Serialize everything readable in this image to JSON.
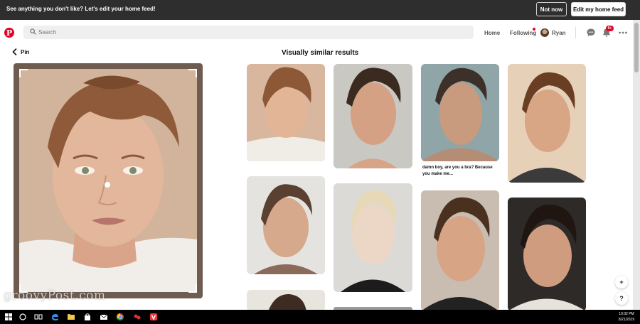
{
  "banner": {
    "message": "See anything you don't like? Let's edit your home feed!",
    "not_now_label": "Not now",
    "edit_label": "Edit my home feed"
  },
  "header": {
    "logo_letter": "P",
    "search_placeholder": "Search",
    "nav": {
      "home": "Home",
      "following": "Following",
      "user": "Ryan"
    },
    "notification_count": "9+",
    "icons": [
      "pinterest-logo-icon",
      "search-icon",
      "messages-icon",
      "notifications-bell-icon",
      "more-options-icon"
    ]
  },
  "pin": {
    "back_label": "Pin"
  },
  "results": {
    "title": "Visually similar results",
    "caption": "damn boy, are you a bra? Because you make me..."
  },
  "floating": {
    "add": "+",
    "help": "?"
  },
  "watermark": "groovyPost.com",
  "taskbar": {
    "time": "10:32 PM",
    "date": "8/21/2019",
    "icons": [
      "windows-start-icon",
      "cortana-search-icon",
      "task-view-icon",
      "edge-icon",
      "file-explorer-icon",
      "store-icon",
      "mail-icon",
      "chrome-icon",
      "app-icon",
      "vivaldi-icon"
    ]
  },
  "colors": {
    "brand": "#e60023",
    "banner_bg": "#2e2e2e",
    "search_bg": "#efefef",
    "taskbar_bg": "#000000"
  }
}
